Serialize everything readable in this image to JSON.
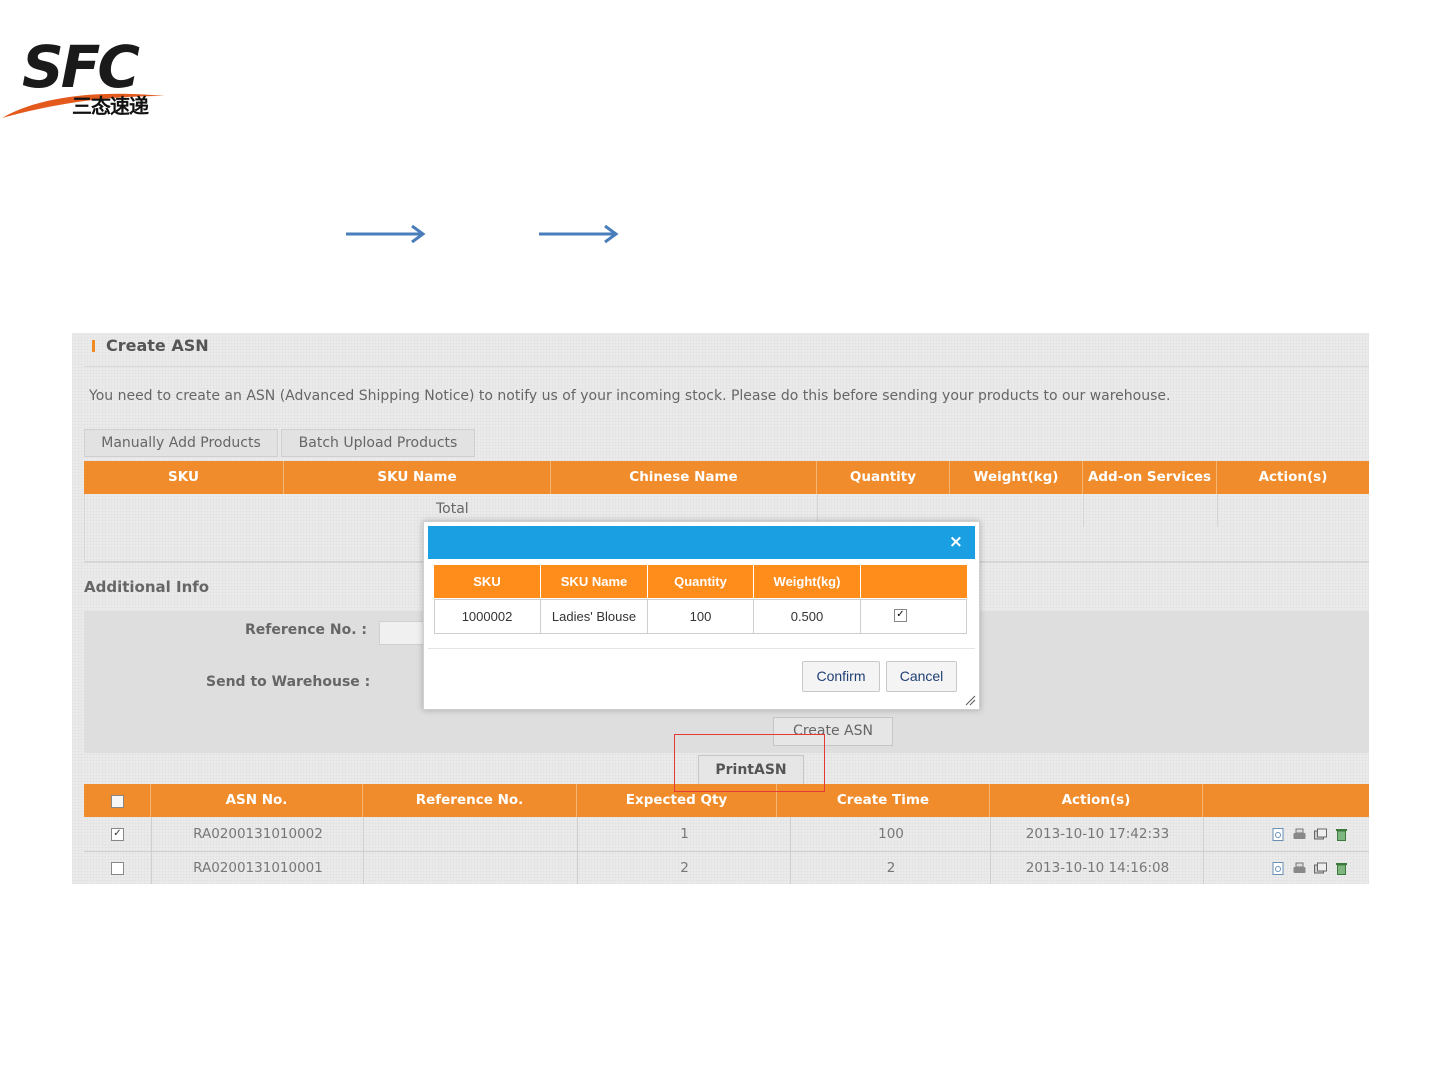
{
  "logo": {
    "text": "SFC",
    "chinese": "三态速递"
  },
  "section": {
    "title": "Create ASN",
    "notice": "You need to create an ASN (Advanced Shipping Notice) to notify us of your incoming stock. Please do this before sending your products to our warehouse."
  },
  "tabs": [
    "Manually Add Products",
    "Batch Upload Products"
  ],
  "product_table": {
    "columns": [
      "SKU",
      "SKU Name",
      "Chinese Name",
      "Quantity",
      "Weight(kg)",
      "Add-on Services",
      "Action(s)"
    ],
    "total_label": "Total"
  },
  "additional_info": {
    "title": "Additional Info",
    "reference_label": "Reference No. :",
    "warehouse_label": "Send to Warehouse :",
    "create_button": "Create ASN",
    "print_button": "PrintASN"
  },
  "asn_table": {
    "columns": [
      "ASN No.",
      "Reference No.",
      "Expected Qty",
      "Create Time",
      "Action(s)"
    ],
    "rows": [
      {
        "checked": true,
        "asn_no": "RA0200131010002",
        "ref": "",
        "expected": "1",
        "qty": "100",
        "time": "2013-10-10 17:42:33"
      },
      {
        "checked": false,
        "asn_no": "RA0200131010001",
        "ref": "",
        "expected": "2",
        "qty": "2",
        "time": "2013-10-10 14:16:08"
      }
    ],
    "action_icons": [
      "view-icon",
      "print-icon",
      "copy-icon",
      "delete-icon"
    ]
  },
  "modal": {
    "close": "×",
    "columns": [
      "SKU",
      "SKU Name",
      "Quantity",
      "Weight(kg)",
      ""
    ],
    "row": {
      "sku": "1000002",
      "name": "Ladies' Blouse",
      "quantity": "100",
      "weight": "0.500",
      "checked": true
    },
    "confirm": "Confirm",
    "cancel": "Cancel"
  },
  "colors": {
    "orange": "#f08c2b",
    "modal_bar": "#1a9fe3",
    "arrow": "#4a7ebb",
    "highlight": "#e53935"
  }
}
